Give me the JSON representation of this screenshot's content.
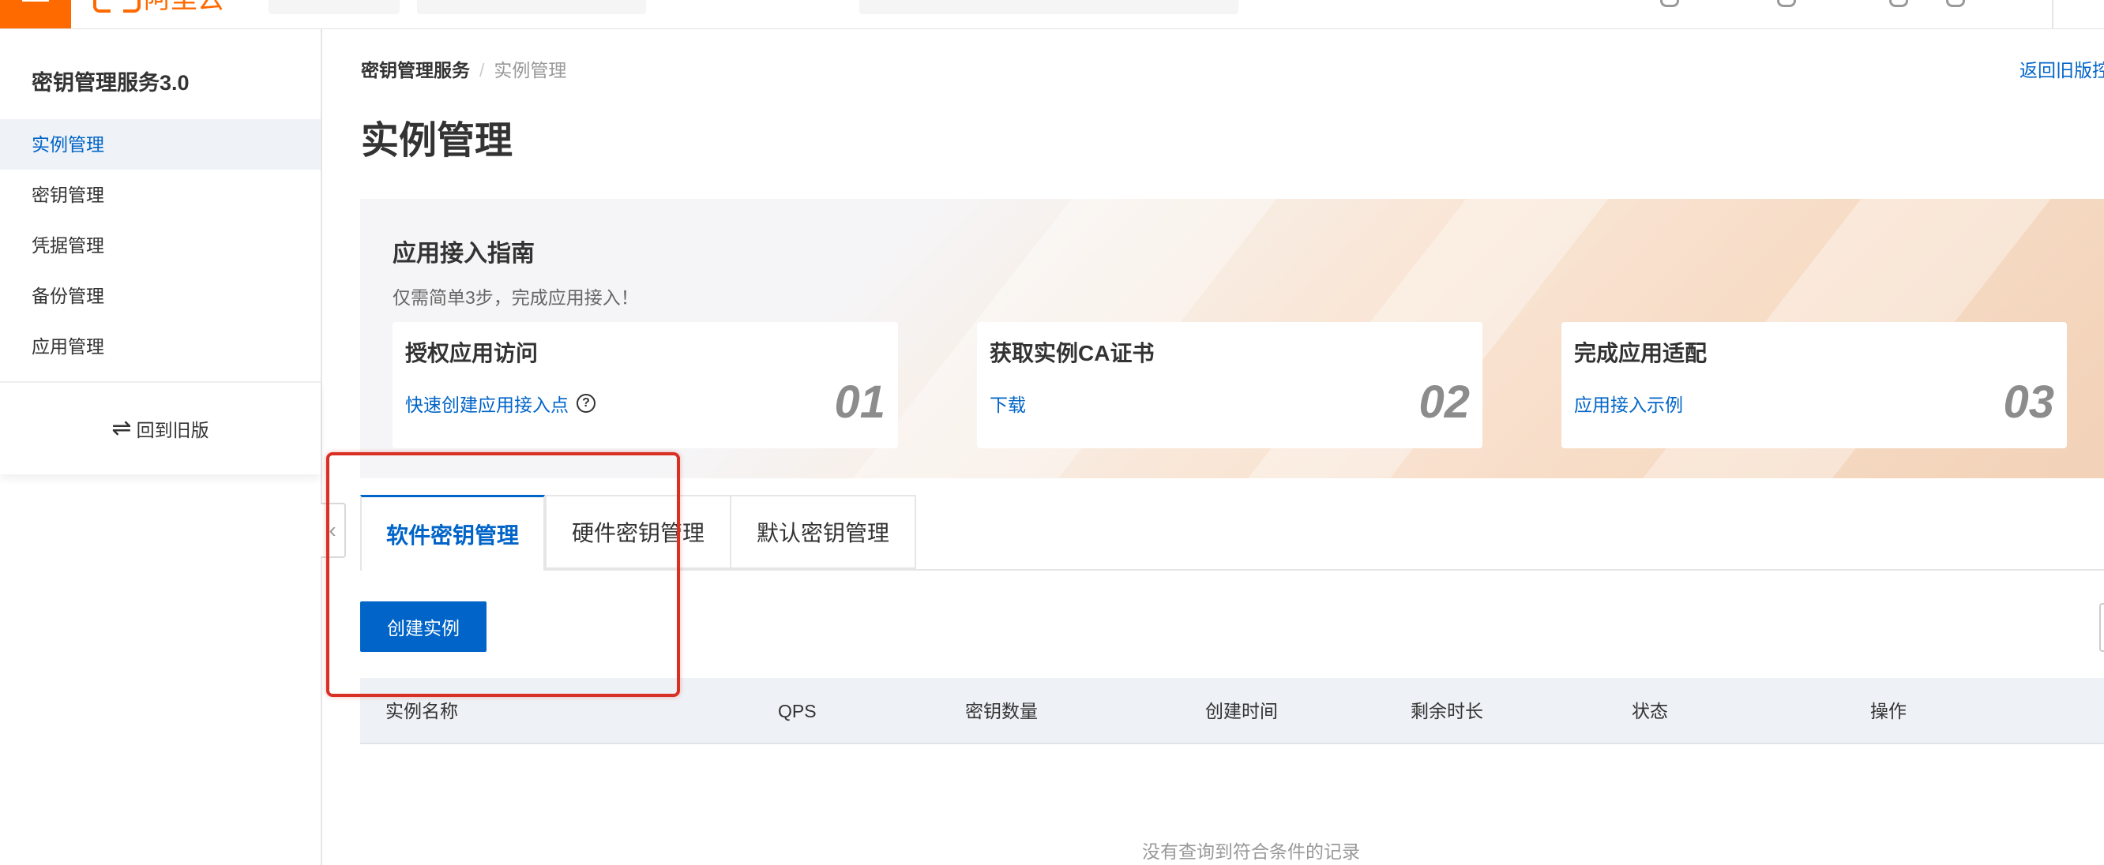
{
  "topbar": {
    "logo_text": "阿里云"
  },
  "sidebar": {
    "title": "密钥管理服务3.0",
    "items": [
      {
        "label": "实例管理",
        "active": true
      },
      {
        "label": "密钥管理",
        "active": false
      },
      {
        "label": "凭据管理",
        "active": false
      },
      {
        "label": "备份管理",
        "active": false
      },
      {
        "label": "应用管理",
        "active": false
      }
    ],
    "back_to_old": "回到旧版"
  },
  "breadcrumb": {
    "root": "密钥管理服务",
    "separator": "/",
    "current": "实例管理"
  },
  "back_old_link": "返回旧版控",
  "page_title": "实例管理",
  "guide": {
    "title": "应用接入指南",
    "subtitle": "仅需简单3步，完成应用接入！",
    "steps": [
      {
        "title": "授权应用访问",
        "link": "快速创建应用接入点",
        "number": "01"
      },
      {
        "title": "获取实例CA证书",
        "link": "下载",
        "number": "02"
      },
      {
        "title": "完成应用适配",
        "link": "应用接入示例",
        "number": "03"
      }
    ]
  },
  "tabs": [
    {
      "label": "软件密钥管理",
      "active": true
    },
    {
      "label": "硬件密钥管理",
      "active": false
    },
    {
      "label": "默认密钥管理",
      "active": false
    }
  ],
  "create_button": "创建实例",
  "table": {
    "columns": [
      "实例名称",
      "QPS",
      "密钥数量",
      "创建时间",
      "剩余时长",
      "状态",
      "操作"
    ],
    "empty_text": "没有查询到符合条件的记录"
  },
  "colors": {
    "brand_orange": "#ff6a00",
    "primary_blue": "#0064c8",
    "highlight_red": "#d93026"
  }
}
